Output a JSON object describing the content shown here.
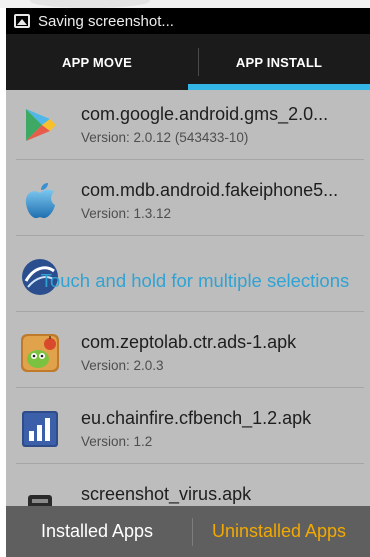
{
  "status_bar": {
    "icon": "screenshot-icon",
    "text": "Saving screenshot..."
  },
  "tabs": [
    {
      "label": "APP MOVE",
      "selected": false
    },
    {
      "label": "APP INSTALL",
      "selected": true
    }
  ],
  "apps": [
    {
      "name": "com.google.android.gms_2.0...",
      "version": "Version: 2.0.12 (543433-10)",
      "icon": "play-services-icon"
    },
    {
      "name": "com.mdb.android.fakeiphone5...",
      "version": "Version: 1.3.12",
      "icon": "apple-logo-icon"
    },
    {
      "name": "",
      "version": "",
      "icon": "app-icon"
    },
    {
      "name": "com.zeptolab.ctr.ads-1.apk",
      "version": "Version: 2.0.3",
      "icon": "cut-the-rope-icon"
    },
    {
      "name": "eu.chainfire.cfbench_1.2.apk",
      "version": "Version: 1.2",
      "icon": "bar-chart-icon"
    },
    {
      "name": "screenshot_virus.apk",
      "version": "",
      "icon": "app-icon"
    }
  ],
  "toast": {
    "text": "Touch and hold for multiple selections"
  },
  "bottom_buttons": {
    "installed": "Installed Apps",
    "uninstalled": "Uninstalled Apps"
  },
  "colors": {
    "accent_blue": "#33b5e5",
    "uninstalled_orange": "#f2a900",
    "toast_text": "#2fa3d4"
  }
}
